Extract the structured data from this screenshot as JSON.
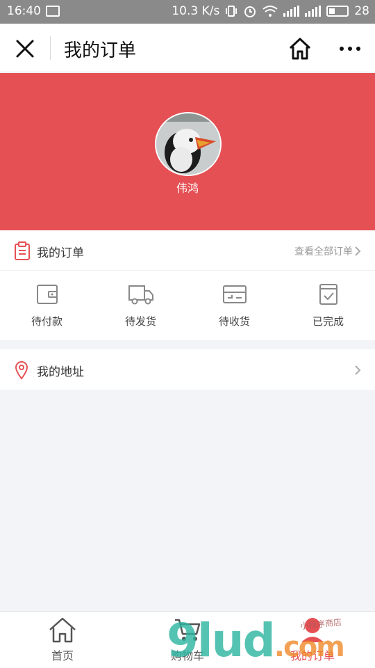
{
  "status_bar": {
    "time": "16:40",
    "speed": "10.3 K/s",
    "battery": "28",
    "network": "4G"
  },
  "titlebar": {
    "title": "我的订单"
  },
  "profile": {
    "username": "伟鸿"
  },
  "orders": {
    "label": "我的订单",
    "view_all": "查看全部订单",
    "statuses": [
      {
        "label": "待付款",
        "icon": "wallet-icon"
      },
      {
        "label": "待发货",
        "icon": "truck-icon"
      },
      {
        "label": "待收货",
        "icon": "package-icon"
      },
      {
        "label": "已完成",
        "icon": "checkbox-icon"
      }
    ]
  },
  "address": {
    "label": "我的地址"
  },
  "tabbar": {
    "items": [
      {
        "label": "首页",
        "icon": "home-icon"
      },
      {
        "label": "购物车",
        "icon": "cart-icon"
      },
      {
        "label": "我的订单",
        "icon": "user-icon",
        "active": true
      }
    ]
  },
  "watermark": {
    "text": "9lud",
    "suffix": ".com",
    "small": "小程序商店"
  },
  "colors": {
    "accent": "#e55054",
    "page_bg": "#f2f4f7"
  }
}
